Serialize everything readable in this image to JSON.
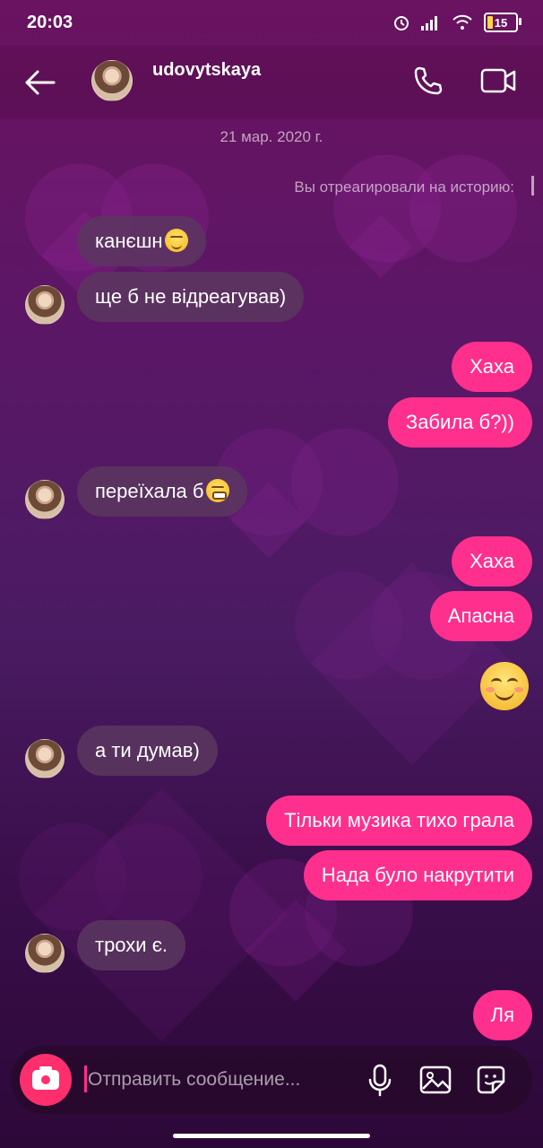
{
  "status_bar": {
    "time": "20:03",
    "battery": "15"
  },
  "header": {
    "username": "udovytskaya"
  },
  "thread": {
    "date": "21 мар. 2020 г.",
    "story_reaction": "Вы отреагировали на историю:"
  },
  "messages": [
    {
      "side": "in",
      "text": "канєшн"
    },
    {
      "side": "in",
      "text": "ще б не відреагував)"
    },
    {
      "side": "out",
      "text": "Хаха"
    },
    {
      "side": "out",
      "text": "Забила б?))"
    },
    {
      "side": "in",
      "text": "переїхала б"
    },
    {
      "side": "out",
      "text": "Хаха"
    },
    {
      "side": "out",
      "text": "Апасна"
    },
    {
      "side": "in",
      "text": "а ти думав)"
    },
    {
      "side": "out",
      "text": "Тільки музика тихо грала"
    },
    {
      "side": "out",
      "text": "Нада було накрутити"
    },
    {
      "side": "in",
      "text": "трохи є."
    },
    {
      "side": "out",
      "text": "Ля"
    }
  ],
  "composer": {
    "placeholder": "Отправить сообщение..."
  },
  "colors": {
    "outgoing_bubble": "#ff2f8e",
    "camera_button": "#ff2f6e"
  }
}
